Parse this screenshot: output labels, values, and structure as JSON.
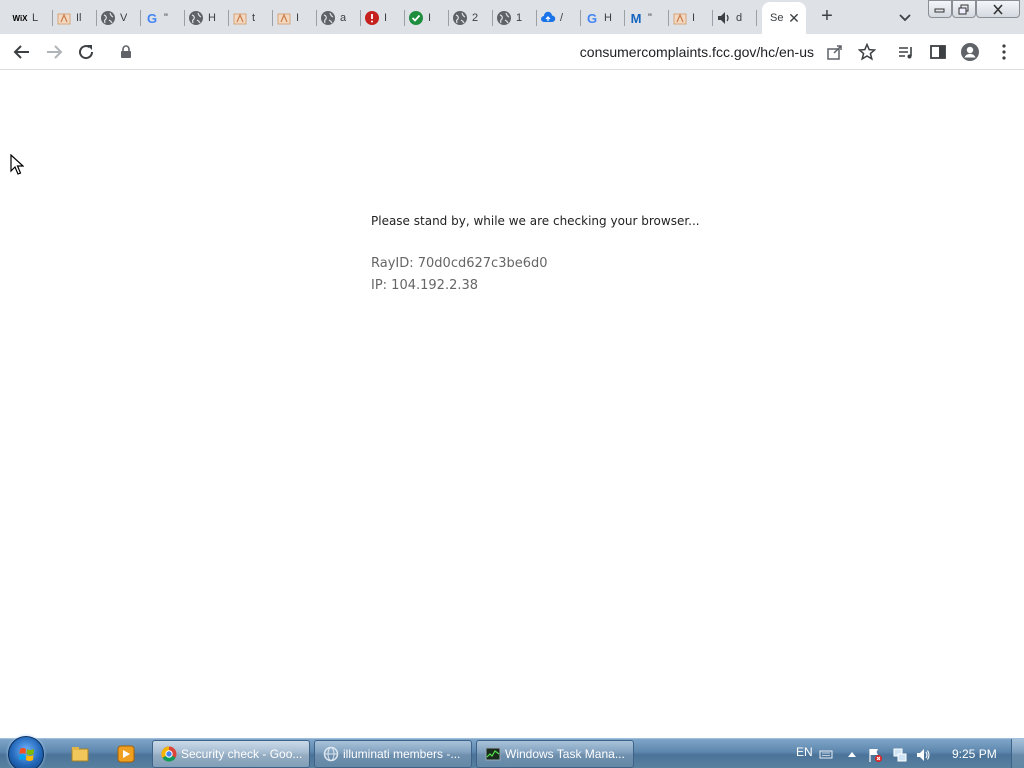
{
  "browser": {
    "tabs": [
      {
        "favicon": "wix-icon",
        "glyph": "WiX",
        "title": "L"
      },
      {
        "favicon": "pdf-icon",
        "glyph": "",
        "title": "Il"
      },
      {
        "favicon": "globe-icon",
        "glyph": "",
        "title": "V"
      },
      {
        "favicon": "google-icon",
        "glyph": "G",
        "title": "\""
      },
      {
        "favicon": "globe-icon",
        "glyph": "",
        "title": "H"
      },
      {
        "favicon": "pdf-icon",
        "glyph": "",
        "title": "t"
      },
      {
        "favicon": "pdf-icon",
        "glyph": "",
        "title": "I"
      },
      {
        "favicon": "globe-icon",
        "glyph": "",
        "title": "a"
      },
      {
        "favicon": "alert-icon",
        "glyph": "",
        "title": "I"
      },
      {
        "favicon": "check-icon",
        "glyph": "",
        "title": "I"
      },
      {
        "favicon": "globe-icon",
        "glyph": "",
        "title": "2"
      },
      {
        "favicon": "globe-icon",
        "glyph": "",
        "title": "1"
      },
      {
        "favicon": "cloud-upload-icon",
        "glyph": "",
        "title": "/"
      },
      {
        "favicon": "google-icon",
        "glyph": "G",
        "title": "H"
      },
      {
        "favicon": "malwarebytes-icon",
        "glyph": "M",
        "title": "\""
      },
      {
        "favicon": "pdf-icon",
        "glyph": "",
        "title": "I"
      },
      {
        "favicon": "audio-icon",
        "glyph": "",
        "title": "d"
      }
    ],
    "active_tab": {
      "title": "Se",
      "close": "✕"
    },
    "new_tab": "+",
    "url": "consumercomplaints.fcc.gov/hc/en-us"
  },
  "page": {
    "standby": "Please stand by, while we are checking your browser...",
    "rayid": "RayID: 70d0cd627c3be6d0",
    "ip": "IP: 104.192.2.38"
  },
  "taskbar": {
    "tasks": [
      {
        "label": "Security check - Goo...",
        "icon": "chrome-icon"
      },
      {
        "label": "illuminati members -...",
        "icon": "network-icon"
      },
      {
        "label": "Windows Task Mana...",
        "icon": "task-manager-icon"
      }
    ],
    "lang": "EN",
    "clock": "9:25 PM"
  },
  "colors": {
    "tabstrip": "#dee1e6",
    "taskbar": "#5d86ad"
  }
}
